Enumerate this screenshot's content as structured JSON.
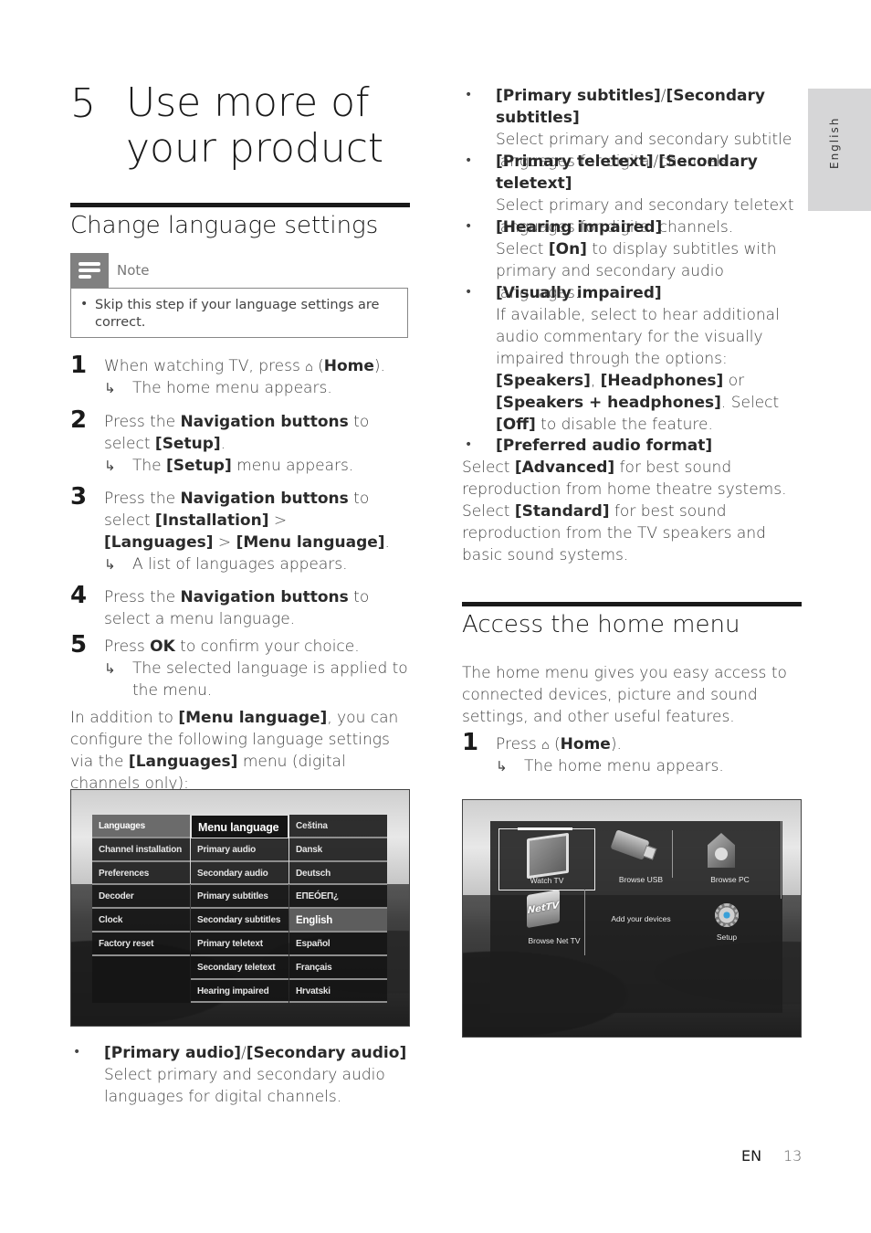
{
  "chapter": {
    "number": "5",
    "title": "Use more of your product"
  },
  "side_tab": {
    "label": "English"
  },
  "section1": {
    "title": "Change language settings",
    "note": {
      "label": "Note",
      "text": "Skip this step if your language settings are correct."
    },
    "steps": [
      {
        "num": "1",
        "pre": "When watching TV, press ",
        "icon": "home-icon",
        "bold": "Home",
        "post_open": " (",
        "post_close": ").",
        "result": "The home menu appears."
      },
      {
        "num": "2",
        "pre": "Press the ",
        "bold": "Navigation buttons",
        "mid": " to select ",
        "bold2": "[Setup]",
        "post": ".",
        "result_pre": "The ",
        "result_bold": "[Setup]",
        "result_post": " menu appears."
      },
      {
        "num": "3",
        "pre": "Press the ",
        "bold": "Navigation buttons",
        "mid": " to select ",
        "bold2": "[Installation]",
        "sep1": " > ",
        "bold3": "[Languages]",
        "sep2": " > ",
        "bold4": "[Menu language]",
        "post": ".",
        "result": "A list of languages appears."
      },
      {
        "num": "4",
        "pre": "Press the ",
        "bold": "Navigation buttons",
        "post": " to select a menu language."
      },
      {
        "num": "5",
        "pre": "Press ",
        "bold": "OK",
        "post": " to confirm your choice.",
        "result": "The selected language is applied to the menu."
      }
    ],
    "intro": {
      "pre": "In addition to ",
      "bold": "[Menu language]",
      "mid": ", you can configure the following language settings via the ",
      "bold2": "[Languages]",
      "post": " menu (digital channels only):"
    },
    "tv_menu": {
      "col1": [
        "Languages",
        "Channel installation",
        "Preferences",
        "Decoder",
        "Clock",
        "Factory reset"
      ],
      "col1_active": "Languages",
      "col2": [
        "Menu language",
        "Primary audio",
        "Secondary audio",
        "Primary subtitles",
        "Secondary subtitles",
        "Primary teletext",
        "Secondary teletext",
        "Hearing impaired"
      ],
      "col3": [
        "Ceština",
        "Dansk",
        "Deutsch",
        "ΕΠΕÓΕΠ¿",
        "English",
        "Español",
        "Français",
        "Hrvatski"
      ],
      "col3_selected": "English"
    },
    "bullets": [
      {
        "title": "[Primary audio]",
        "sep": "/",
        "title2": "[Secondary audio]",
        "desc": "Select primary and secondary audio languages for digital channels."
      }
    ]
  },
  "right_bullets": [
    {
      "title": "[Primary subtitles]",
      "sep": "/",
      "title2": "[Secondary subtitles]",
      "desc": "Select primary and secondary subtitle languages for digital channels."
    },
    {
      "title": "[Primary teletext]",
      "sep": "/",
      "title2": "[Secondary teletext]",
      "desc": "Select primary and secondary teletext languages for digital channels."
    },
    {
      "title": "[Hearing impaired]",
      "desc_pre": "Select ",
      "desc_bold": "[On]",
      "desc_post": " to display subtitles with primary and secondary audio languages."
    },
    {
      "title": "[Visually impaired]",
      "d1": "If available, select to hear additional audio commentary for the visually impaired through the options: ",
      "b1": "[Speakers]",
      "d2": ", ",
      "b2": "[Headphones]",
      "d3": " or ",
      "b3": "[Speakers + headphones]",
      "d4": ". Select ",
      "b4": "[Off]",
      "d5": " to disable the feature."
    },
    {
      "title": "[Preferred audio format]"
    }
  ],
  "audio_format_text": {
    "p1": "Select ",
    "b1": "[Advanced]",
    "p2": " for best sound reproduction from home theatre systems. Select ",
    "b2": "[Standard]",
    "p3": " for best sound reproduction from the TV speakers and basic sound systems."
  },
  "section2": {
    "title": "Access the home menu",
    "intro": "The home menu gives you easy access to connected devices, picture and sound settings, and other useful features.",
    "step": {
      "num": "1",
      "pre": "Press ",
      "icon": "home-icon",
      "bold": "Home",
      "result": "The home menu appears."
    },
    "home_menu": {
      "tiles": [
        "Watch TV",
        "Browse USB",
        "Browse PC",
        "Browse Net TV",
        "Add your devices",
        "Setup"
      ],
      "selected": "Watch TV",
      "net_logo": "NetTV"
    }
  },
  "footer": {
    "lang": "EN",
    "page": "13"
  }
}
